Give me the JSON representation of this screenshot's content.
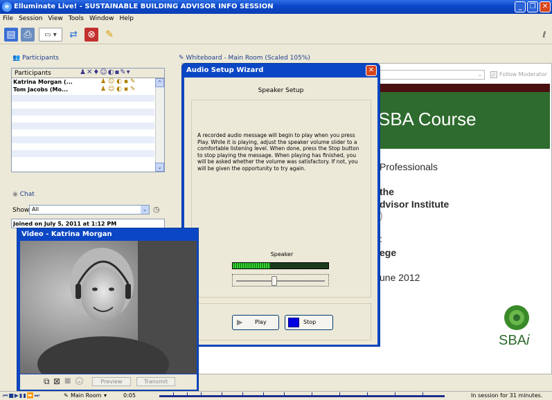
{
  "window": {
    "title": "Elluminate Live! - SUSTAINABLE BUILDING ADVISOR INFO SESSION"
  },
  "menu": [
    "File",
    "Session",
    "View",
    "Tools",
    "Window",
    "Help"
  ],
  "participants": {
    "header": "Participants",
    "column": "Participants",
    "rows": [
      "Katrina Morgan (...",
      "Tom Jacobs (Mo..."
    ]
  },
  "chat": {
    "header": "Chat",
    "show_label": "Show",
    "show_value": "All",
    "first_line": "Joined on July 5, 2011 at 1:12 PM"
  },
  "whiteboard": {
    "header": "Whiteboard - Main Room (Scaled 105%)",
    "follow_moderator": "Follow Moderator"
  },
  "slide": {
    "title": "SBA Course",
    "lines": [
      "Professionals",
      "the",
      "dvisor Institute",
      ")",
      ":",
      "ege",
      "une 2012"
    ],
    "logo_text": "SBA",
    "logo_suffix": "i"
  },
  "wizard": {
    "title": "Audio Setup Wizard",
    "section": "Speaker Setup",
    "instructions": "A recorded audio message will begin to play when you press Play.  While it is playing, adjust the speaker volume slider to a comfortable listening level.  When done, press the Stop button to stop playing the message. When playing has finished, you will be asked whether the volume was satisfactory.  If not, you will be given the opportunity to try again.",
    "speaker_label": "Speaker",
    "meter_level": 0.39,
    "slider_level": 0.42,
    "play_label": "Play",
    "stop_label": "Stop"
  },
  "video": {
    "title": "Video - Katrina Morgan",
    "preview_label": "Preview",
    "transmit_label": "Transmit"
  },
  "status": {
    "room": "Main Room",
    "time": "0:05",
    "session": "In session for 31 minutes."
  },
  "colors": {
    "titlebar": "#0a46c8",
    "slide_green": "#2e6b2e",
    "stop_blue": "#0000e0"
  }
}
